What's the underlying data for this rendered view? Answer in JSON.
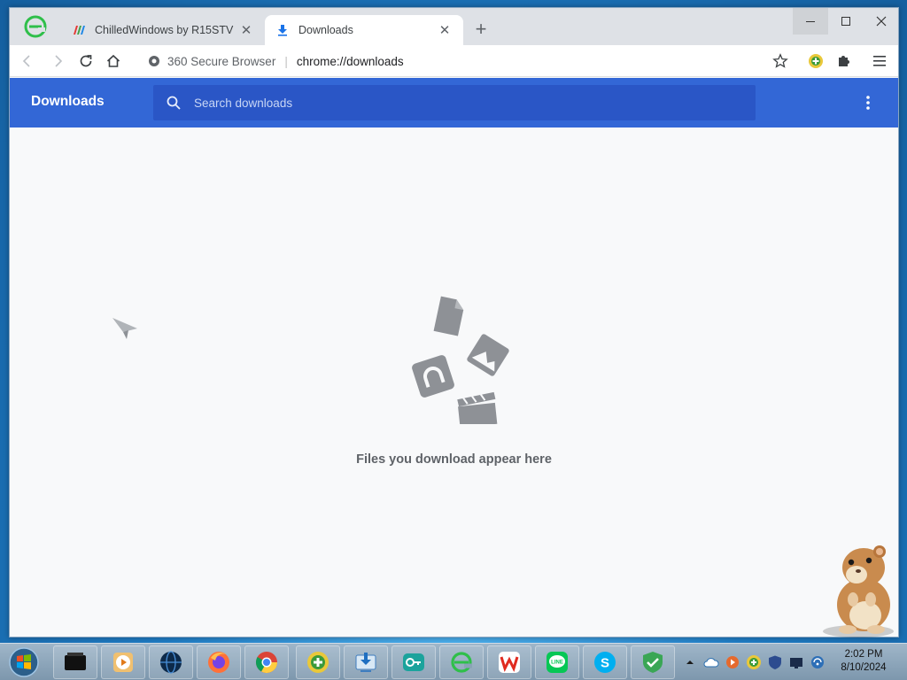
{
  "browser": {
    "tabs": [
      {
        "label": "ChilledWindows by R15STV",
        "active": false
      },
      {
        "label": "Downloads",
        "active": true
      }
    ],
    "omnibox": {
      "site_label": "360 Secure Browser",
      "separator": "|",
      "url": "chrome://downloads"
    }
  },
  "downloads": {
    "title": "Downloads",
    "search_placeholder": "Search downloads",
    "empty_message": "Files you download appear here"
  },
  "taskbar": {
    "clock_time": "2:02 PM",
    "clock_date": "8/10/2024"
  },
  "colors": {
    "header_blue": "#3367d6",
    "search_blue": "#2a56c6",
    "page_bg": "#f8f9fa"
  }
}
